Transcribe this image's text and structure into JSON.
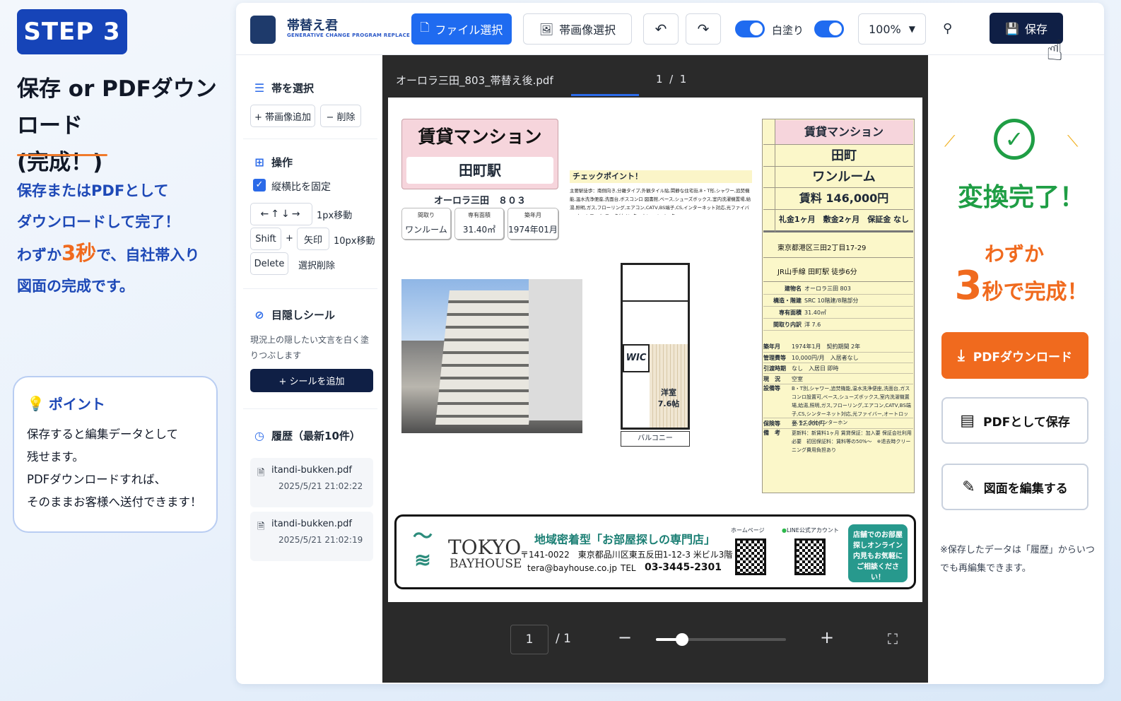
{
  "left": {
    "step": "STEP 3",
    "title_line1": "保存 or PDFダウンロード",
    "title_line2": "(完成！)",
    "desc_line1": "保存またはPDFとして",
    "desc_line2": "ダウンロードして完了！",
    "desc_line3_pre": "わずか",
    "desc_line3_num": "3秒",
    "desc_line3_post": "で、自社帯入り",
    "desc_line4": "図面の完成です。",
    "point_title": "ポイント",
    "point_lines": [
      "保存すると編集データとして",
      "残せます。",
      "PDFダウンロードすれば、",
      "そのままお客様へ送付できます！"
    ]
  },
  "toolbar": {
    "app_name": "帯替え君",
    "app_sub": "GENERATIVE CHANGE PROGRAM REPLACE",
    "file_select": "ファイル選択",
    "band_image_select": "帯画像選択",
    "whiteout": "白塗り",
    "zoom": "100%",
    "save": "保存"
  },
  "sidebar": {
    "band_section": "帯を選択",
    "add_band": "+ 帯画像追加",
    "delete": "− 削除",
    "ops_section": "操作",
    "keep_ratio": "縦横比を固定",
    "move1": "1px移動",
    "shift": "Shift",
    "plus": "+",
    "arrow_key": "矢印",
    "move10": "10px移動",
    "delete_key": "Delete",
    "delete_selected": "選択削除",
    "seal_section": "目隠しシール",
    "seal_desc": "現況上の隠したい文言を白く塗りつぶします",
    "add_seal": "+ シールを追加",
    "history_section": "履歴（最新10件）",
    "history": [
      {
        "file": "itandi-bukken.pdf",
        "date": "2025/5/21 21:02:22"
      },
      {
        "file": "itandi-bukken.pdf",
        "date": "2025/5/21 21:02:19"
      }
    ]
  },
  "viewer": {
    "filename": "オーロラ三田_803_帯替え後.pdf",
    "page_current": "1",
    "page_sep": "/",
    "page_total": "1",
    "page_input": "1",
    "page_total_label": "/ 1",
    "zoom_level": 0.2
  },
  "pdf": {
    "banner_title": "賃貸マンション",
    "station": "田町駅",
    "building": "オーロラ三田　８０３",
    "spec_labels": [
      "間取り",
      "専有面積",
      "築年月"
    ],
    "spec_values": [
      "ワンルーム",
      "31.40㎡",
      "1974年01月"
    ],
    "check_title": "チェックポイント！",
    "check_text": "主要駅徒歩：南側向き,分離タイプ,外観タイル貼,閑静な住宅街,8・T形,シャワー,追焚機能,温水洗浄便座,洗面台,ボスコン口 図書館,ベース,シューズボックス,室内洗濯機置場,給湯,照明,ガス,フローリング,エアコン,CATV,BS端子,CS,インターネット対応,光ファイバー,オートロック,モニタ付インターホン,エレベーター",
    "fp_wic": "WIC",
    "fp_room": "洋室",
    "fp_size": "7.6帖",
    "fp_balcony": "バルコニー",
    "right_type": "賃貸マンション",
    "right_station": "田町",
    "right_layout": "ワンルーム",
    "right_rent": "賃料 146,000円",
    "right_terms": "礼金1ヶ月　敷金2ヶ月　保証金 なし",
    "right_address": "東京都港区三田2丁目17-29",
    "right_access": "JR山手線 田町駅 徒歩6分",
    "rt_rows": [
      [
        "建物名",
        "オーロラ三田 803"
      ],
      [
        "構造・階建",
        "SRC 10階建/8階部分"
      ],
      [
        "専有面積",
        "31.40㎡"
      ],
      [
        "間取り内訳",
        "洋 7.6"
      ],
      [
        "築年月",
        "1974年1月　契約期間 2年"
      ],
      [
        "管理費等",
        "10,000円/月　入居者なし"
      ],
      [
        "引渡時期",
        "なし　入居日 即時"
      ],
      [
        "現　況",
        "空室"
      ],
      [
        "設備等",
        "B・T別,シャワー,追焚機能,温水洗浄便座,洗面台,ガスコンロ設置可,ベース,シューズボックス,室内洗濯機置場,給湯,照明,ガス,フローリング,エアコン,CATV,BS端子,CS,シンターネット対応,光ファイバー,オートロック,モニタ付インターホン"
      ],
      [
        "保険等",
        "要 22,000円"
      ],
      [
        "備　考",
        "更新料：新賃料1ヶ月 賃貸保証：加入要 保証会社利用必要　初回保証料：賃料等の50%〜　※退去時クリーニング費用負担あり"
      ]
    ],
    "footer_brand1": "TOKYO",
    "footer_brand2": "BAYHOUSE",
    "footer_tag": "地域密着型「お部屋探しの専門店」",
    "footer_address": "〒141-0022　東京都品川区東五反田1-12-3 米ビル3階",
    "footer_email": "tera@bayhouse.co.jp",
    "footer_tel_label": "TEL",
    "footer_tel": "03-3445-2301",
    "footer_hp": "ホームページ",
    "footer_line": "LINE公式アカウント",
    "footer_badge": "店舗でのお部屋探しオンライン内見もお気軽にご相談ください！"
  },
  "right_panel": {
    "done": "変換完了！",
    "wazuka": "わずか",
    "three": "3",
    "three_post": "秒で完成！",
    "pdf_download": "PDFダウンロード",
    "save_as_pdf": "PDFとして保存",
    "edit": "図面を編集する",
    "note": "※保存したデータは「履歴」からいつでも再編集できます。"
  },
  "colors": {
    "accent": "#1f6bf0",
    "navy": "#0f1f45",
    "orange": "#f06a1e",
    "green": "#1f9e45"
  }
}
